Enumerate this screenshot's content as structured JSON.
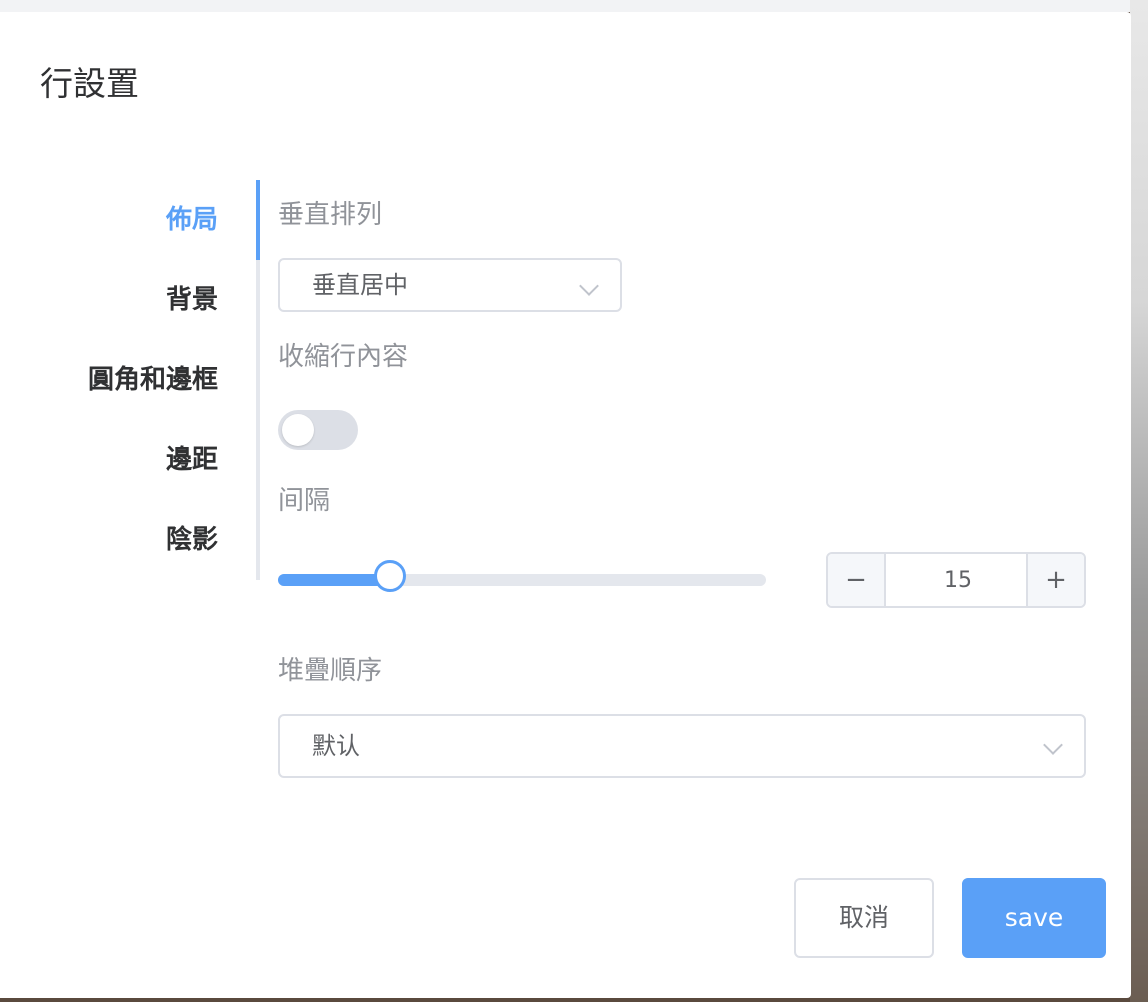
{
  "dialog": {
    "title": "行設置"
  },
  "tabs": [
    {
      "label": "佈局",
      "active": true
    },
    {
      "label": "背景",
      "active": false
    },
    {
      "label": "圓角和邊框",
      "active": false
    },
    {
      "label": "邊距",
      "active": false
    },
    {
      "label": "陰影",
      "active": false
    }
  ],
  "form": {
    "vertical_align": {
      "label": "垂直排列",
      "value": "垂直居中"
    },
    "shrink_content": {
      "label": "收縮行內容",
      "enabled": false
    },
    "gap": {
      "label": "间隔",
      "slider_fraction": 0.23,
      "value": "15",
      "decrement": "−",
      "increment": "+"
    },
    "stack_order": {
      "label": "堆疊順序",
      "value": "默认"
    }
  },
  "footer": {
    "cancel_label": "取消",
    "save_label": "save"
  },
  "colors": {
    "accent": "#5aa0f7",
    "border": "#dcdfe6",
    "label": "#909399",
    "text": "#303133"
  }
}
